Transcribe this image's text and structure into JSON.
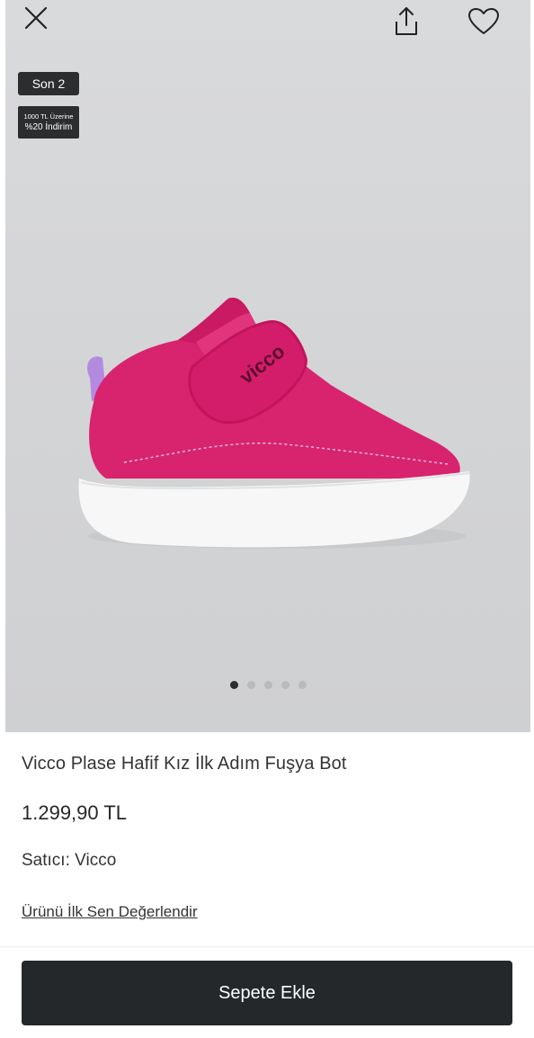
{
  "header": {
    "close_icon": "close-icon",
    "share_icon": "share-icon",
    "favorite_icon": "heart-icon"
  },
  "badges": {
    "stock": "Son 2",
    "discount_line1": "1000 TL Üzerine",
    "discount_line2": "%20 İndirim"
  },
  "gallery": {
    "image_brand_text": "vicco",
    "dots_count": 5,
    "active_dot": 0
  },
  "product": {
    "title": "Vicco Plase Hafif Kız İlk Adım Fuşya Bot",
    "price": "1.299,90 TL",
    "seller_label": "Satıcı:",
    "seller_name": "Vicco",
    "review_link": "Ürünü İlk Sen Değerlendir"
  },
  "actions": {
    "add_to_cart": "Sepete Ekle"
  },
  "colors": {
    "button_bg": "#25282b",
    "badge_bg": "#2b2d2f",
    "shoe_pink": "#d8236f",
    "sole_white": "#f7f7f7"
  }
}
